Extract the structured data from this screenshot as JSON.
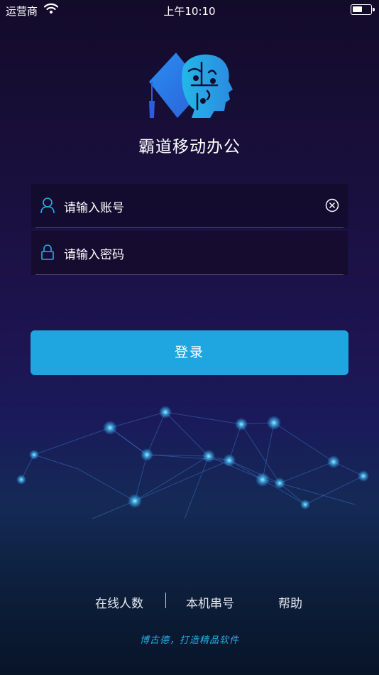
{
  "status_bar": {
    "carrier": "运营商",
    "time": "上午10:10"
  },
  "app": {
    "title": "霸道移动办公"
  },
  "login_form": {
    "account_placeholder": "请输入账号",
    "password_placeholder": "请输入密码",
    "login_label": "登录"
  },
  "footer": {
    "links": [
      "在线人数",
      "本机串号",
      "帮助"
    ],
    "slogan": "博古德，打造精品软件"
  },
  "colors": {
    "accent": "#1fa5e0",
    "background": "#1a1040",
    "icon": "#21b0e8"
  }
}
